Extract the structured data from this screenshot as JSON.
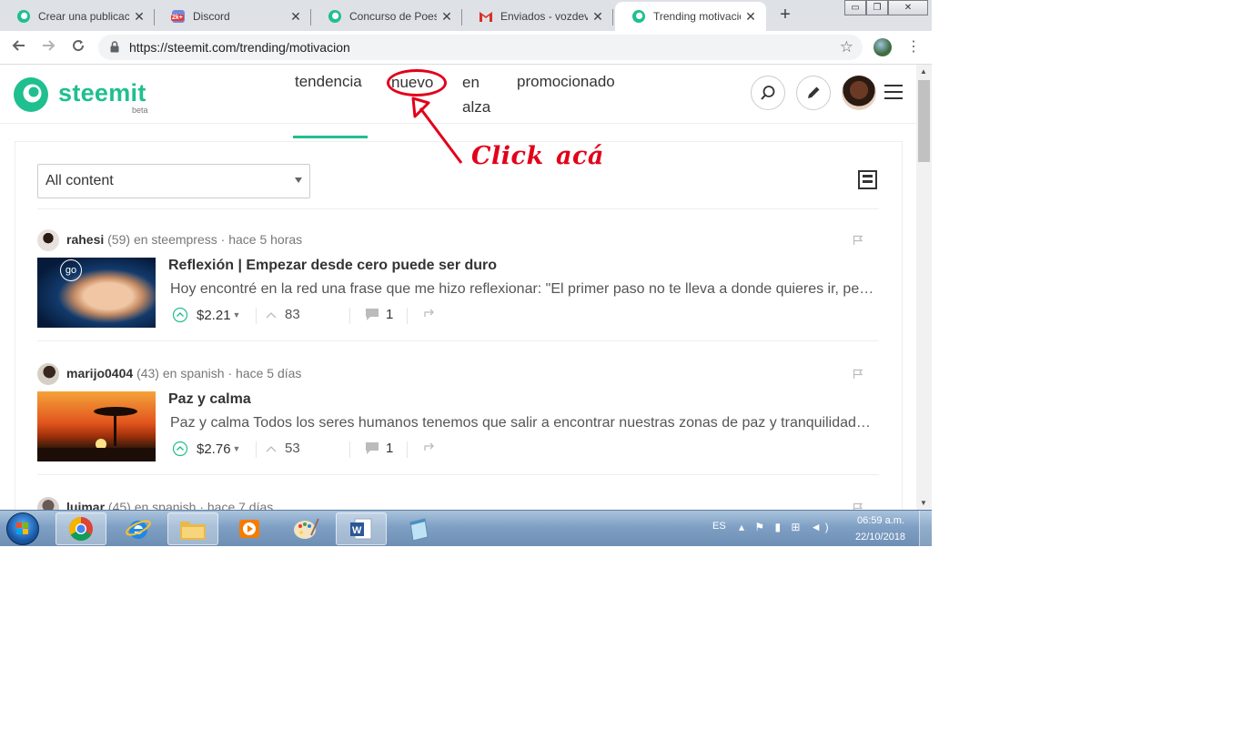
{
  "browser": {
    "tabs": [
      {
        "title": "Crear una publicació",
        "favicon": "steemit-icon",
        "active": false
      },
      {
        "title": "Discord",
        "favicon": "discord-icon",
        "badge": "2k+",
        "active": false
      },
      {
        "title": "Concurso de Poesía",
        "favicon": "steemit-icon",
        "active": false
      },
      {
        "title": "Enviados - vozdevida",
        "favicon": "gmail-icon",
        "active": false
      },
      {
        "title": "Trending motivacion",
        "favicon": "steemit-icon",
        "active": true
      }
    ],
    "url": "https://steemit.com/trending/motivacion"
  },
  "site": {
    "brand": "steemit",
    "beta": "beta",
    "nav": {
      "trending": "tendencia",
      "new": "nuevo",
      "hot_line1": "en",
      "hot_line2": "alza",
      "promoted": "promocionado"
    }
  },
  "filter": {
    "selected": "All content"
  },
  "posts": [
    {
      "author": "rahesi",
      "reputation": "(59)",
      "category_text": "en steempress",
      "time": "hace 5 horas",
      "title": "Reflexión | Empezar desde cero puede ser duro",
      "summary": "Hoy encontré en la red una frase que me hizo reflexionar: \"El primer paso no te lleva a donde quieres ir, pero te saca de donde estás\".",
      "payout": "$2.21",
      "votes": "83",
      "comments": "1",
      "thumb_label": "go"
    },
    {
      "author": "marijo0404",
      "reputation": "(43)",
      "category_text": "en spanish",
      "time": "hace 5 días",
      "title": "Paz y calma",
      "summary": "Paz y calma Todos los seres humanos tenemos que salir a encontrar nuestras zonas de paz y tranquilidad, a lo largo de la vida.",
      "payout": "$2.76",
      "votes": "53",
      "comments": "1"
    },
    {
      "author": "luimar",
      "reputation": "(45)",
      "category_text": "en spanish",
      "time": "hace 7 días"
    }
  ],
  "taskbar": {
    "lang": "ES",
    "time": "06:59 a.m.",
    "date": "22/10/2018"
  },
  "annotation": {
    "word1": "Click",
    "word2": "acá",
    "color": "#e2001a"
  },
  "colors": {
    "brand": "#1fbf8f",
    "tabstrip": "#dee1e6"
  }
}
